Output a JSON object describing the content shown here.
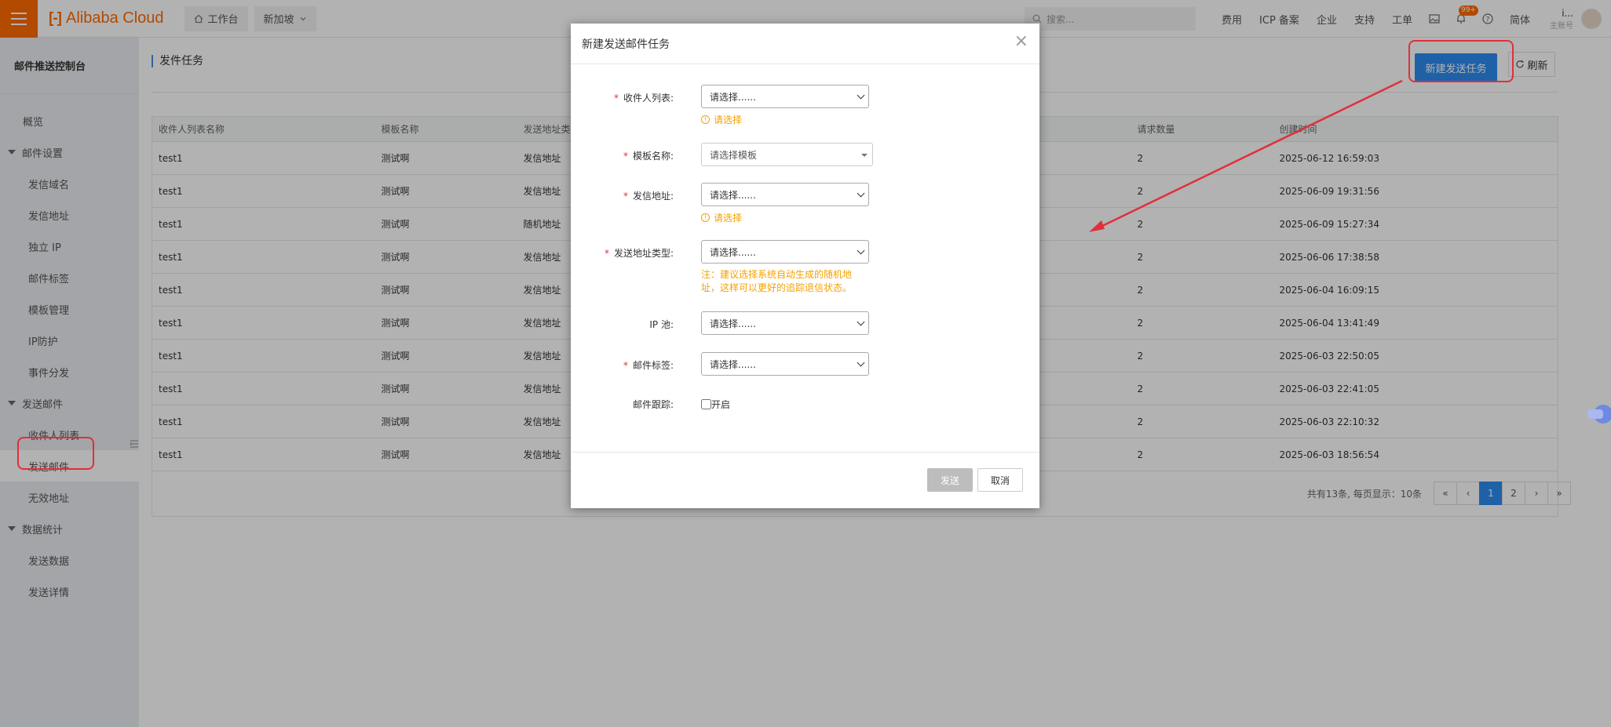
{
  "topbar": {
    "logo": "Alibaba Cloud",
    "logo_mark": "[-]",
    "workbench": "工作台",
    "region": "新加坡",
    "search_placeholder": "搜索...",
    "nav": [
      "费用",
      "ICP 备案",
      "企业",
      "支持",
      "工单"
    ],
    "badge": "99+",
    "lang": "简体",
    "account_name": "i...",
    "account_role": "主账号"
  },
  "sidebar": {
    "title": "邮件推送控制台",
    "overview": "概览",
    "group_mail_settings": "邮件设置",
    "mail_settings": [
      "发信域名",
      "发信地址",
      "独立 IP",
      "邮件标签",
      "模板管理",
      "IP防护",
      "事件分发"
    ],
    "group_send_mail": "发送邮件",
    "send_mail": [
      "收件人列表",
      "发送邮件",
      "无效地址"
    ],
    "group_stats": "数据统计",
    "stats": [
      "发送数据",
      "发送详情"
    ]
  },
  "main": {
    "page_title": "发件任务",
    "new_task": "新建发送任务",
    "refresh": "刷新",
    "columns": [
      "收件人列表名称",
      "模板名称",
      "发送地址类",
      "请求数量",
      "创建时间"
    ],
    "rows": [
      [
        "test1",
        "测试啊",
        "发信地址",
        "2",
        "2025-06-12 16:59:03"
      ],
      [
        "test1",
        "测试啊",
        "发信地址",
        "2",
        "2025-06-09 19:31:56"
      ],
      [
        "test1",
        "测试啊",
        "随机地址",
        "2",
        "2025-06-09 15:27:34"
      ],
      [
        "test1",
        "测试啊",
        "发信地址",
        "2",
        "2025-06-06 17:38:58"
      ],
      [
        "test1",
        "测试啊",
        "发信地址",
        "2",
        "2025-06-04 16:09:15"
      ],
      [
        "test1",
        "测试啊",
        "发信地址",
        "2",
        "2025-06-04 13:41:49"
      ],
      [
        "test1",
        "测试啊",
        "发信地址",
        "2",
        "2025-06-03 22:50:05"
      ],
      [
        "test1",
        "测试啊",
        "发信地址",
        "2",
        "2025-06-03 22:41:05"
      ],
      [
        "test1",
        "测试啊",
        "发信地址",
        "2",
        "2025-06-03 22:10:32"
      ],
      [
        "test1",
        "测试啊",
        "发信地址",
        "2",
        "2025-06-03 18:56:54"
      ]
    ],
    "pager_info": "共有13条, 每页显示：10条",
    "pager": [
      "«",
      "‹",
      "1",
      "2",
      "›",
      "»"
    ]
  },
  "modal": {
    "title": "新建发送邮件任务",
    "close": "×",
    "required_mark": "*",
    "recipient_label": "收件人列表:",
    "recipient_value": "请选择......",
    "warn_text": "请选择",
    "template_label": "模板名称:",
    "template_value": "请选择模板",
    "sender_label": "发信地址:",
    "sender_value": "请选择......",
    "addrtype_label": "发送地址类型:",
    "addrtype_value": "请选择......",
    "addrtype_note": "注：建议选择系统自动生成的随机地址，这样可以更好的追踪退信状态。",
    "ippool_label": "IP 池:",
    "ippool_value": "请选择......",
    "tag_label": "邮件标签:",
    "tag_value": "请选择......",
    "track_label": "邮件跟踪:",
    "track_option": "开启",
    "send": "发送",
    "cancel": "取消"
  },
  "colors": {
    "brand": "#ff6a00",
    "primary": "#2d8cf0",
    "warning": "#f5a100",
    "annotation": "#e0303a"
  }
}
